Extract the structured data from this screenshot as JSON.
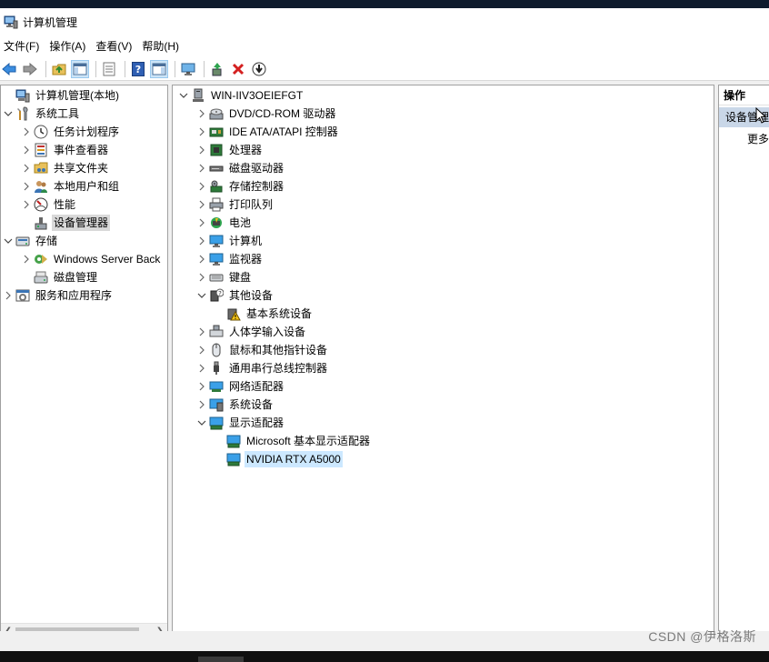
{
  "window": {
    "title": "计算机管理"
  },
  "menu": [
    "文件(F)",
    "操作(A)",
    "查看(V)",
    "帮助(H)"
  ],
  "toolbar": {
    "buttons": [
      "back-icon",
      "forward-icon",
      "up-folder-icon",
      "show-hide-tree-icon",
      "properties-icon",
      "help-icon",
      "action-pane-icon",
      "monitor-icon",
      "update-driver-icon",
      "uninstall-icon",
      "download-icon"
    ]
  },
  "left_tree": [
    {
      "label": "计算机管理(本地)",
      "icon": "computer-management-icon",
      "expand": "none"
    },
    {
      "label": "系统工具",
      "icon": "tools-icon",
      "expand": "expanded"
    },
    {
      "label": "任务计划程序",
      "icon": "clock-icon",
      "expand": "collapsed"
    },
    {
      "label": "事件查看器",
      "icon": "event-viewer-icon",
      "expand": "collapsed"
    },
    {
      "label": "共享文件夹",
      "icon": "shared-folder-icon",
      "expand": "collapsed"
    },
    {
      "label": "本地用户和组",
      "icon": "users-icon",
      "expand": "collapsed"
    },
    {
      "label": "性能",
      "icon": "performance-icon",
      "expand": "collapsed"
    },
    {
      "label": "设备管理器",
      "icon": "device-manager-icon",
      "expand": "none",
      "selected": true
    },
    {
      "label": "存储",
      "icon": "storage-icon",
      "expand": "expanded"
    },
    {
      "label": "Windows Server Back",
      "icon": "backup-icon",
      "expand": "collapsed"
    },
    {
      "label": "磁盘管理",
      "icon": "disk-management-icon",
      "expand": "none"
    },
    {
      "label": "服务和应用程序",
      "icon": "services-icon",
      "expand": "collapsed"
    }
  ],
  "device_tree": [
    {
      "label": "WIN-IIV3OEIEFGT",
      "icon": "computer-root-icon",
      "expand": "expanded"
    },
    {
      "label": "DVD/CD-ROM 驱动器",
      "icon": "dvd-drive-icon",
      "expand": "collapsed"
    },
    {
      "label": "IDE ATA/ATAPI 控制器",
      "icon": "ide-controller-icon",
      "expand": "collapsed"
    },
    {
      "label": "处理器",
      "icon": "processor-icon",
      "expand": "collapsed"
    },
    {
      "label": "磁盘驱动器",
      "icon": "disk-drive-icon",
      "expand": "collapsed"
    },
    {
      "label": "存储控制器",
      "icon": "storage-controller-icon",
      "expand": "collapsed"
    },
    {
      "label": "打印队列",
      "icon": "printer-icon",
      "expand": "collapsed"
    },
    {
      "label": "电池",
      "icon": "battery-icon",
      "expand": "collapsed"
    },
    {
      "label": "计算机",
      "icon": "computer-icon",
      "expand": "collapsed"
    },
    {
      "label": "监视器",
      "icon": "monitor-icon",
      "expand": "collapsed"
    },
    {
      "label": "键盘",
      "icon": "keyboard-icon",
      "expand": "collapsed"
    },
    {
      "label": "其他设备",
      "icon": "other-devices-icon",
      "expand": "expanded"
    },
    {
      "label": "基本系统设备",
      "icon": "warning-device-icon",
      "expand": "none"
    },
    {
      "label": "人体学输入设备",
      "icon": "hid-icon",
      "expand": "collapsed"
    },
    {
      "label": "鼠标和其他指针设备",
      "icon": "mouse-icon",
      "expand": "collapsed"
    },
    {
      "label": "通用串行总线控制器",
      "icon": "usb-icon",
      "expand": "collapsed"
    },
    {
      "label": "网络适配器",
      "icon": "network-adapter-icon",
      "expand": "collapsed"
    },
    {
      "label": "系统设备",
      "icon": "system-devices-icon",
      "expand": "collapsed"
    },
    {
      "label": "显示适配器",
      "icon": "display-adapter-icon",
      "expand": "expanded"
    },
    {
      "label": "Microsoft 基本显示适配器",
      "icon": "display-adapter-icon",
      "expand": "none"
    },
    {
      "label": "NVIDIA RTX A5000",
      "icon": "display-adapter-icon",
      "expand": "none",
      "selected": true
    }
  ],
  "actions": {
    "header": "操作",
    "section": "设备管理",
    "more": "更多"
  },
  "watermark": "CSDN @伊格洛斯",
  "colors": {
    "selection_blue": "#cce8ff",
    "selection_grey": "#d9d9d9",
    "actions_section": "#c9d7e8",
    "pressed_button": "#cce4f7"
  }
}
